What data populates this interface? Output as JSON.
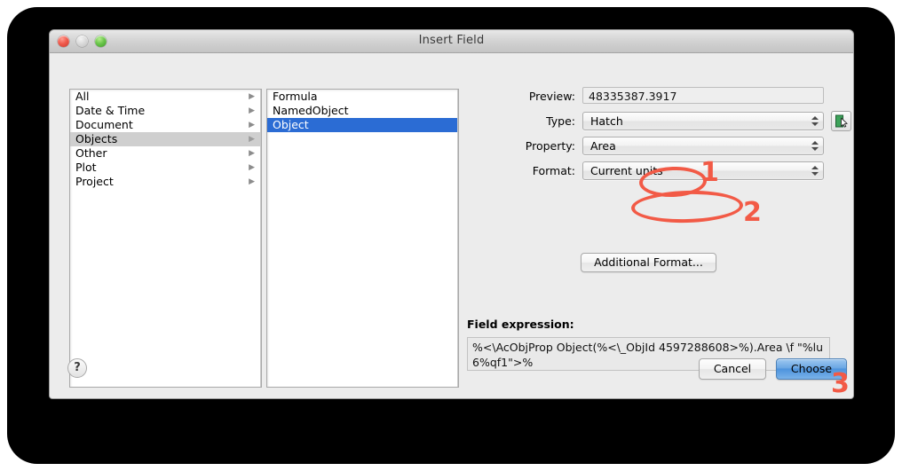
{
  "window": {
    "title": "Insert Field",
    "traffic_lights": [
      "close",
      "minimize",
      "zoom"
    ]
  },
  "categories_list": {
    "items": [
      {
        "label": "All",
        "selected": false
      },
      {
        "label": "Date & Time",
        "selected": false
      },
      {
        "label": "Document",
        "selected": false
      },
      {
        "label": "Objects",
        "selected": true
      },
      {
        "label": "Other",
        "selected": false
      },
      {
        "label": "Plot",
        "selected": false
      },
      {
        "label": "Project",
        "selected": false
      }
    ],
    "disclosure_glyph": "▶"
  },
  "types_list": {
    "items": [
      {
        "label": "Formula",
        "selected": false
      },
      {
        "label": "NamedObject",
        "selected": false
      },
      {
        "label": "Object",
        "selected": true
      }
    ]
  },
  "form": {
    "preview": {
      "label": "Preview:",
      "value": "48335387.3917"
    },
    "type": {
      "label": "Type:",
      "value": "Hatch"
    },
    "property": {
      "label": "Property:",
      "value": "Area"
    },
    "format": {
      "label": "Format:",
      "value": "Current units"
    },
    "pick_button_icon": "object-picker-icon",
    "additional_format_label": "Additional Format..."
  },
  "field_expression": {
    "label": "Field expression:",
    "value": "%<\\AcObjProp Object(%<\\_ObjId 4597288608>%).Area \\f \"%lu6%qf1\">%"
  },
  "footer": {
    "help_label": "?",
    "cancel_label": "Cancel",
    "choose_label": "Choose"
  },
  "annotations": {
    "color": "#f25a46",
    "markers": [
      {
        "number": "1",
        "targets": "property-value"
      },
      {
        "number": "2",
        "targets": "format-value"
      },
      {
        "number": "3",
        "targets": "choose-button"
      }
    ]
  },
  "colors": {
    "selection_blue": "#2b6cd4",
    "selection_gray": "#cfcfcf",
    "annotation_red": "#f25a46",
    "window_chrome": "#ececec",
    "backdrop": "#000000"
  }
}
